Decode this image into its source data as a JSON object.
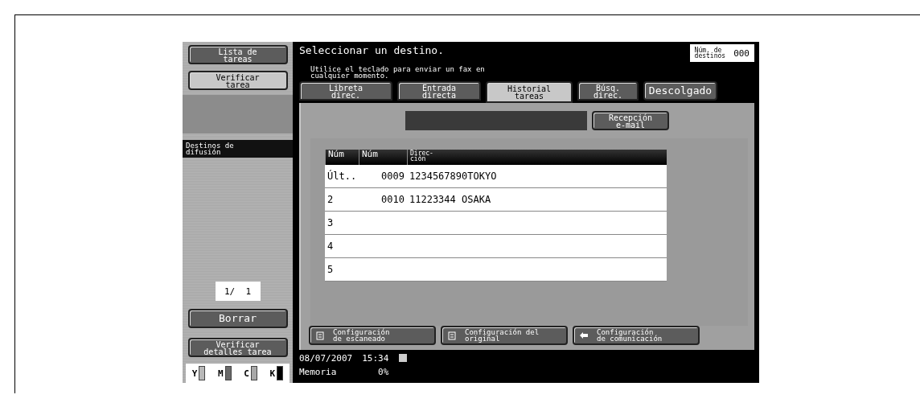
{
  "left_panel": {
    "buttons": [
      {
        "label": "Lista de\ntareas",
        "selected": false
      },
      {
        "label": "Verificar\ntarea",
        "selected": true
      }
    ],
    "broadcast_header": "Destinos de\ndifusión",
    "page_counter": "1/  1",
    "clear_button": "Borrar",
    "details_button": "Verificar\ndetalles tarea",
    "toners": [
      {
        "label": "Y",
        "color": "#b8b8b8"
      },
      {
        "label": "M",
        "color": "#6a6a6a"
      },
      {
        "label": "C",
        "color": "#a8a8a8"
      },
      {
        "label": "K",
        "color": "#000000"
      }
    ]
  },
  "header": {
    "title": "Seleccionar un destino.",
    "hint": "Utilice el teclado para enviar un fax en\ncualquier momento.",
    "dest_count_label": "Núm. de\ndestinos",
    "dest_count": "000"
  },
  "tabs": [
    {
      "label": "Libreta\ndirec.",
      "selected": false
    },
    {
      "label": "Entrada\ndirecta",
      "selected": false
    },
    {
      "label": "Historial\ntareas",
      "selected": true
    },
    {
      "label": "Búsq.\ndirec.",
      "selected": false
    }
  ],
  "offhook_button": "Descolgado",
  "email_button": "Recepción\ne-mail",
  "table": {
    "columns": [
      "Núm",
      "Núm",
      "Direc-\nción"
    ],
    "rows": [
      [
        "Últ..",
        "0009",
        "1234567890TOKYO"
      ],
      [
        "2",
        "0010",
        "11223344 OSAKA"
      ],
      [
        "3",
        "",
        ""
      ],
      [
        "4",
        "",
        ""
      ],
      [
        "5",
        "",
        ""
      ]
    ]
  },
  "settings_buttons": [
    {
      "kind": "scan",
      "label": "Configuración\nde escaneado"
    },
    {
      "kind": "original",
      "label": "Configuración del\noriginal"
    },
    {
      "kind": "comm",
      "label": "Configuración\nde comunicación"
    }
  ],
  "status": {
    "date": "08/07/2007",
    "time": "15:34",
    "memory_label": "Memoria",
    "memory": "0%"
  }
}
